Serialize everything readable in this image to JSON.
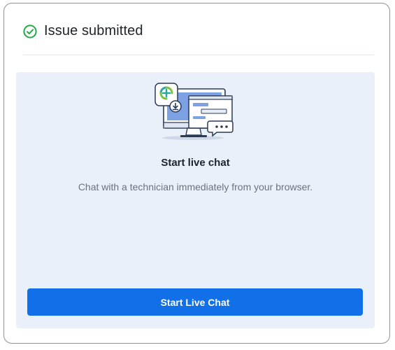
{
  "header": {
    "title": "Issue submitted",
    "status_icon": "check-circle-icon",
    "status_color": "#22a846"
  },
  "live_chat": {
    "illustration": "live-chat-illustration",
    "title": "Start live chat",
    "description": "Chat with a technician immediately from your browser.",
    "button_label": "Start Live Chat",
    "accent_color": "#1170e8",
    "panel_color": "#eaf0fa"
  }
}
